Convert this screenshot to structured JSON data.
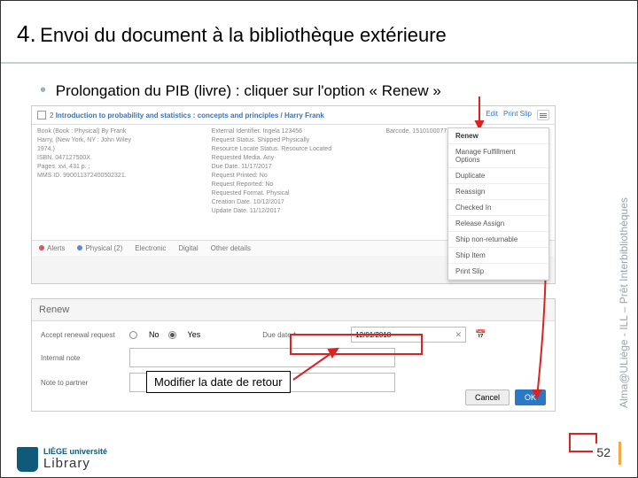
{
  "title": {
    "num": "4.",
    "text": "Envoi du document à la bibliothèque extérieure"
  },
  "bullet": "Prolongation du PIB (livre) : cliquer sur l'option « Renew »",
  "shot1": {
    "title_link": "Introduction to probability and statistics : concepts and principles / Harry Frank",
    "actions": {
      "edit": "Edit",
      "print": "Print Slip"
    },
    "colA": [
      "Book (Book : Physical) By Frank",
      "Harry, (New York, NY : John Wiley",
      "1974.)",
      "ISBN. 047127500X",
      "Pages. xvi, 431 p. ;",
      "MMS ID. 990011372400502321."
    ],
    "colB": [
      "External Identifier. Ingela 123456",
      "Request Status. Shipped Physically",
      "Resource Locate Status. Resource Located",
      "Requested Media. Any",
      "Due Date. 11/17/2017",
      "Request Printed: No",
      "Request Reported: No",
      "Requested Format. Physical",
      "Creation Date. 10/12/2017",
      "Update Date. 11/12/2017"
    ],
    "colC": "Barcode. 1510100077",
    "tabs": [
      "Alerts",
      "Physical (2)",
      "Electronic",
      "Digital",
      "Other details"
    ],
    "dropdown": [
      "Renew",
      "Manage Fulfillment Options",
      "Duplicate",
      "Reassign",
      "Checked In",
      "Release Assign",
      "Ship non-returnable",
      "Ship Item",
      "Print Slip"
    ]
  },
  "shot2": {
    "head": "Renew",
    "accept_label": "Accept renewal request",
    "no": "No",
    "yes": "Yes",
    "due_label": "Due date *",
    "due_value": "12/01/2018",
    "internal": "Internal note",
    "note_to": "Note to partner",
    "cancel": "Cancel",
    "ok": "OK"
  },
  "annot": {
    "modify": "Modifier la date de retour"
  },
  "sidebar": "Alma@ULiège - ILL – Prêt Interbibliothèques",
  "page": "52",
  "logo": {
    "uni": "LIÈGE université",
    "lib": "Library"
  }
}
